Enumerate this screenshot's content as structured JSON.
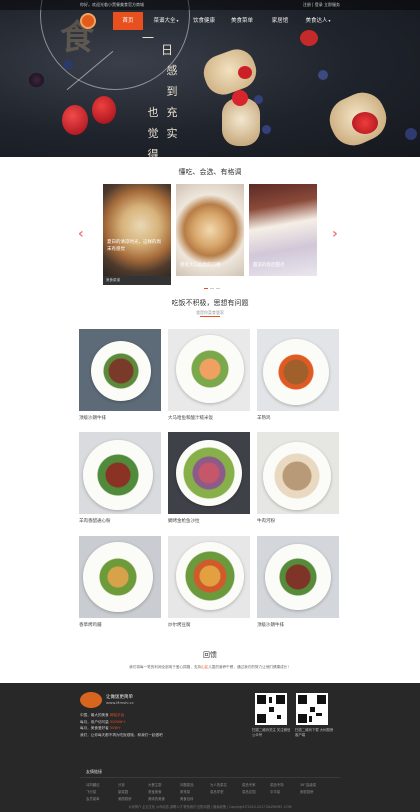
{
  "topbar": {
    "welcome": "你好，欢迎光临小黑餐美食官方商城",
    "links": "注册 | 登录  立即服务"
  },
  "nav": {
    "items": [
      {
        "label": "首页",
        "active": true
      },
      {
        "label": "菜谱大全",
        "active": false
      },
      {
        "label": "饮食健康",
        "active": false
      },
      {
        "label": "美食菜单",
        "active": false
      },
      {
        "label": "家居馆",
        "active": false
      },
      {
        "label": "美食达人",
        "active": false
      }
    ]
  },
  "hero": {
    "poem_col1": "一",
    "poem_col2": "日",
    "poem_col3": "感到充实",
    "poem_col4": "也觉得满满"
  },
  "section1": {
    "title": "懂吃、会选、有格调"
  },
  "carousel": [
    {
      "caption": "夏日的清凉时光，这样的周末有感觉",
      "foot": "美食菜谱"
    },
    {
      "caption": "感受大口品尝的口感",
      "foot": ""
    },
    {
      "caption": "甜美的饭后甜点",
      "foot": ""
    }
  ],
  "section2": {
    "title": "吃饭不积极，思想有问题",
    "subtitle": "我是你菜食管家"
  },
  "dishes": [
    {
      "label": "顶级沙朗牛排"
    },
    {
      "label": "大马哈鱼和酸汁糙米饭"
    },
    {
      "label": "羊熟鸡"
    },
    {
      "label": "羊肉香醋通心粉"
    },
    {
      "label": "鲷烤金枪鱼沙拉"
    },
    {
      "label": "牛肉河粉"
    },
    {
      "label": "香草烤鸡脯"
    },
    {
      "label": "炒尔烤豆腐"
    },
    {
      "label": "顶级沙朗牛排"
    }
  ],
  "review": {
    "title": "回馈",
    "text_a": "我们将每一笔的利润全部用于爱心捐赠，支持",
    "text_hl": "山区",
    "text_b": "儿童的营养午餐，通过我们的努力让他们健康成长！"
  },
  "footer": {
    "brand": "让做饭更简单",
    "brand_sub": "www.Mmshi.cc",
    "lines": [
      {
        "a": "中国，最大的美食",
        "b": "网站平台"
      },
      {
        "a": "每月，用户访问量",
        "b": "5000W+"
      },
      {
        "a": "每月，美食爱好者",
        "b": "50W+"
      },
      {
        "a": "我们，让你每天都不再为吃饭烦恼，和我们一起做吧",
        "b": ""
      }
    ],
    "qr1_caption": "扫描二维码关注 关注微信公众号",
    "qr2_caption": "扫描二维码下载 大树厨房客户端",
    "links_title": "友情链接",
    "links": [
      "诗风翩证",
      "分钟",
      "大餐主厨",
      "问题菜品",
      "为人的菜名",
      "菜品专家",
      "菜品专场",
      "36°高级菜",
      "飞行菜",
      "豪菜园",
      "滚宝美食",
      "家常菜",
      "菜品学堂",
      "菜品花园",
      "中华菜",
      "家庭厨房",
      "会员菜单",
      "美丽厨房",
      "美味的美食",
      "美食百科"
    ],
    "copyright": "公司简介  企业文化  公司动态  诚聘人才  联系我们  回馈问题  | 隐私政策 | Copyright©2015-2017 DAZHIMEI .COM"
  }
}
